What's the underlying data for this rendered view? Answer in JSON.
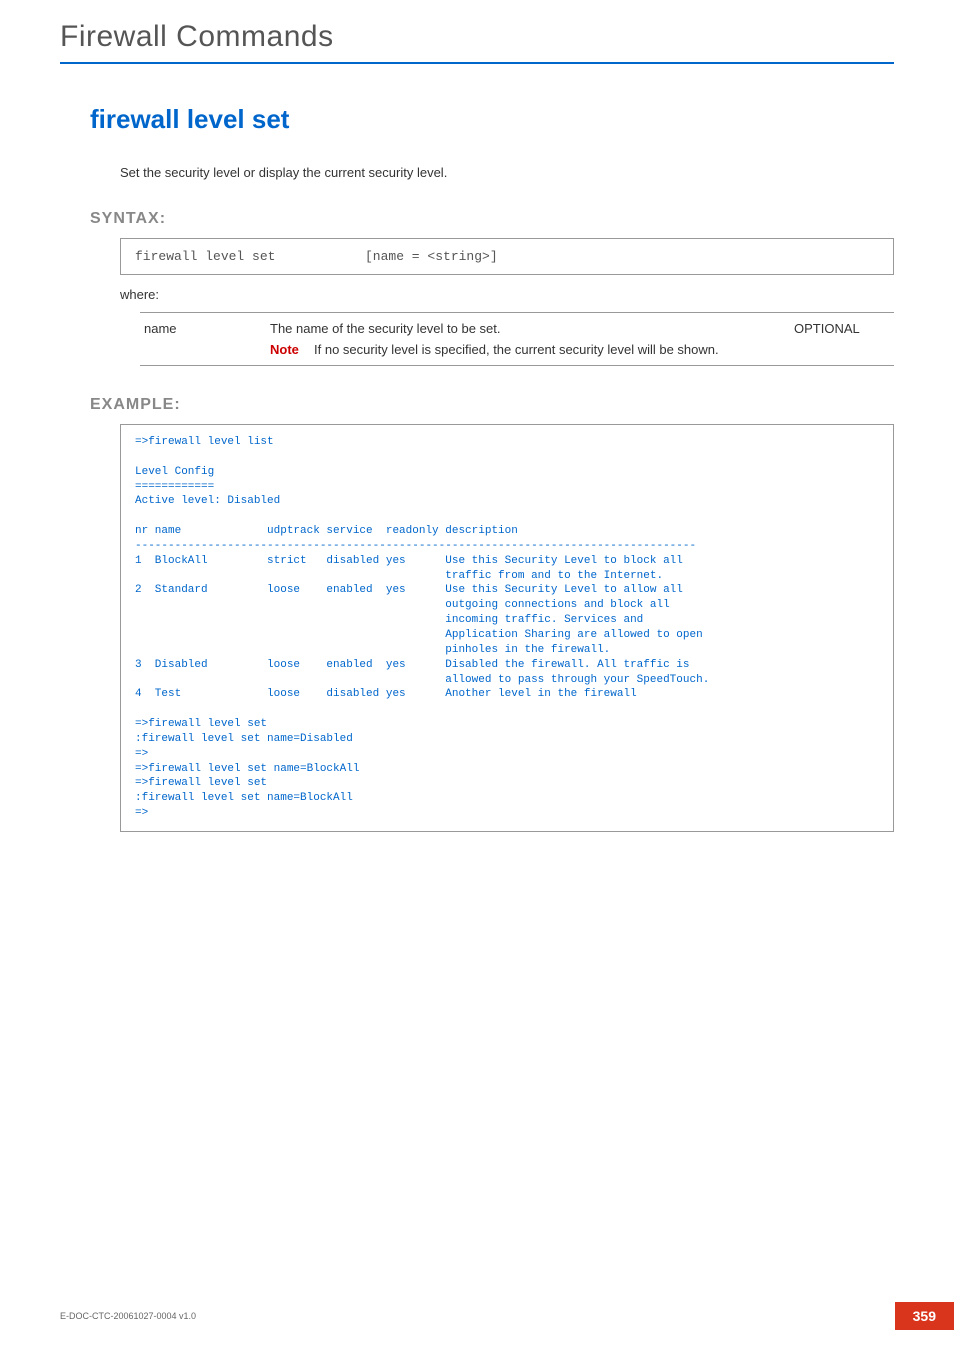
{
  "chapter": "Firewall Commands",
  "command": "firewall level set",
  "description": "Set the security level or display the current security level.",
  "labels": {
    "syntax": "SYNTAX:",
    "example": "EXAMPLE:",
    "where": "where:",
    "note": "Note"
  },
  "syntax": {
    "cmd": "firewall level set",
    "args": "[name = <string>]"
  },
  "params": [
    {
      "name": "name",
      "desc": "The name of the security level to be set.",
      "note": "If no security level is specified, the current security level will be shown.",
      "optional": "OPTIONAL"
    }
  ],
  "example": "=>firewall level list\n\nLevel Config\n============\nActive level: Disabled\n\nnr name             udptrack service  readonly description\n-------------------------------------------------------------------------------------\n1  BlockAll         strict   disabled yes      Use this Security Level to block all\n                                               traffic from and to the Internet.\n2  Standard         loose    enabled  yes      Use this Security Level to allow all\n                                               outgoing connections and block all\n                                               incoming traffic. Services and\n                                               Application Sharing are allowed to open\n                                               pinholes in the firewall.\n3  Disabled         loose    enabled  yes      Disabled the firewall. All traffic is\n                                               allowed to pass through your SpeedTouch.\n4  Test             loose    disabled yes      Another level in the firewall\n\n=>firewall level set\n:firewall level set name=Disabled\n=>\n=>firewall level set name=BlockAll\n=>firewall level set\n:firewall level set name=BlockAll\n=>",
  "footer": {
    "docid": "E-DOC-CTC-20061027-0004 v1.0",
    "page": "359"
  }
}
